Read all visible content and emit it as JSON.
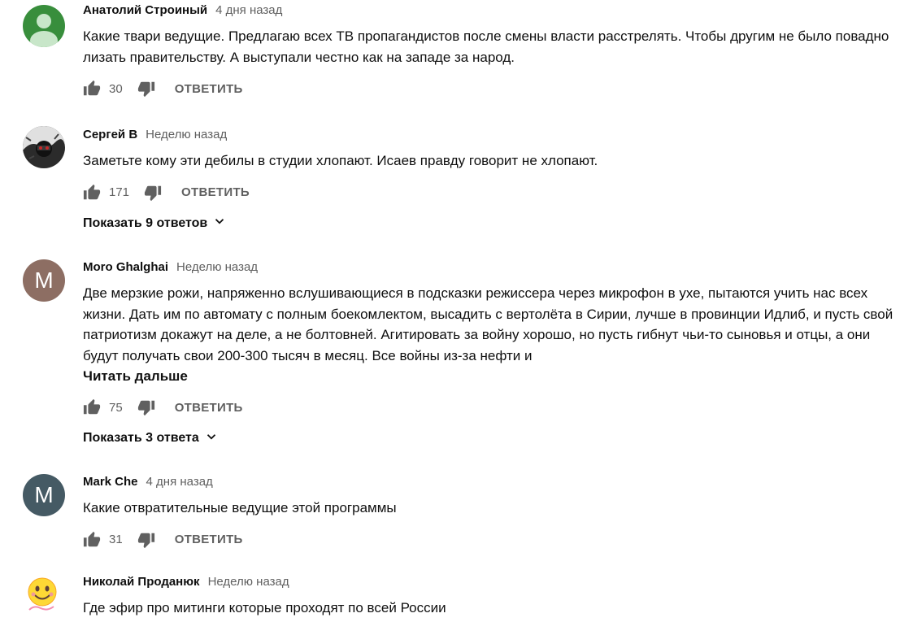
{
  "comments": [
    {
      "author": "Анатолий Строиный",
      "time": "4 дня назад",
      "avatar_color": "#388e3c",
      "text": "Какие твари ведущие. Предлагаю всех ТВ пропагандистов после смены власти расстрелять. Чтобы другим не было повадно лизать правительству. А выступали честно как на западе за народ.",
      "likes": "30",
      "reply_label": "ОТВЕТИТЬ"
    },
    {
      "author": "Сергей В",
      "time": "Неделю назад",
      "text": "Заметьте кому эти дебилы в студии хлопают. Исаев правду говорит не хлопают.",
      "likes": "171",
      "reply_label": "ОТВЕТИТЬ",
      "replies_label": "Показать 9 ответов"
    },
    {
      "author": "Moro Ghalghai",
      "time": "Неделю назад",
      "avatar_letter": "M",
      "avatar_color": "#8d6e63",
      "text": "Две мерзкие рожи, напряженно вслушивающиеся в подсказки режиссера через микрофон в ухе, пытаются учить нас всех жизни. Дать им по автомату с полным боекомлектом, высадить с вертолёта в Сирии, лучше в провинции Идлиб, и пусть свой патриотизм докажут на деле, а не болтовней. Агитировать за войну хорошо, но пусть гибнут чьи-то сыновья и отцы, а они будут получать свои 200-300 тысяч в месяц. Все войны из-за нефти и",
      "read_more": "Читать дальше",
      "likes": "75",
      "reply_label": "ОТВЕТИТЬ",
      "replies_label": "Показать 3 ответа"
    },
    {
      "author": "Mark Che",
      "time": "4 дня назад",
      "avatar_letter": "M",
      "avatar_color": "#455a64",
      "text": "Какие отвратительные ведущие этой программы",
      "likes": "31",
      "reply_label": "ОТВЕТИТЬ"
    },
    {
      "author": "Николай Проданюк",
      "time": "Неделю назад",
      "text": "Где эфир про митинги которые проходят по всей России"
    }
  ],
  "icons": {
    "like": "thumb-up-icon",
    "dislike": "thumb-down-icon",
    "expand": "chevron-down-icon"
  },
  "colors": {
    "icon": "#606060",
    "secondary_text": "#606060",
    "primary_text": "#0f0f0f"
  }
}
